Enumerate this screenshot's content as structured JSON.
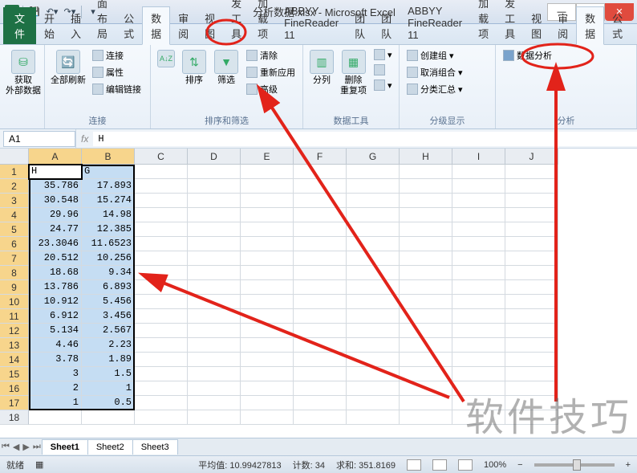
{
  "titlebar": {
    "title": "分析数据.xlsx - Microsoft Excel"
  },
  "tabs": {
    "file": "文件",
    "items": [
      "开始",
      "插入",
      "页面布局",
      "公式",
      "数据",
      "审阅",
      "视图",
      "开发工具",
      "加载项",
      "ABBYY FineReader 11",
      "团队"
    ],
    "active_index": 4
  },
  "ribbon": {
    "group_get_data": {
      "btn": "获取\n外部数据",
      "label": ""
    },
    "group_connections": {
      "refresh": "全部刷新",
      "items": [
        "连接",
        "属性",
        "编辑链接"
      ],
      "label": "连接"
    },
    "group_sort_filter": {
      "sort": "排序",
      "filter": "筛选",
      "items": [
        "清除",
        "重新应用",
        "高级"
      ],
      "label": "排序和筛选"
    },
    "group_data_tools": {
      "text_to_cols": "分列",
      "remove_dup": "删除\n重复项",
      "label": "数据工具"
    },
    "group_outline": {
      "items": [
        "创建组",
        "取消组合",
        "分类汇总"
      ],
      "label": "分级显示"
    },
    "group_analysis": {
      "btn": "数据分析",
      "label": "分析"
    }
  },
  "namebox": "A1",
  "formula": "H",
  "columns": [
    "A",
    "B",
    "C",
    "D",
    "E",
    "F",
    "G",
    "H",
    "I",
    "J"
  ],
  "headers": {
    "A": "H",
    "B": "G"
  },
  "chart_data": {
    "type": "table",
    "columns": [
      "H",
      "G"
    ],
    "rows": [
      [
        35.786,
        17.893
      ],
      [
        30.548,
        15.274
      ],
      [
        29.96,
        14.98
      ],
      [
        24.77,
        12.385
      ],
      [
        23.3046,
        11.6523
      ],
      [
        20.512,
        10.256
      ],
      [
        18.68,
        9.34
      ],
      [
        13.786,
        6.893
      ],
      [
        10.912,
        5.456
      ],
      [
        6.912,
        3.456
      ],
      [
        5.134,
        2.567
      ],
      [
        4.46,
        2.23
      ],
      [
        3.78,
        1.89
      ],
      [
        3,
        1.5
      ],
      [
        2,
        1
      ],
      [
        1,
        0.5
      ]
    ]
  },
  "sheet_tabs": [
    "Sheet1",
    "Sheet2",
    "Sheet3"
  ],
  "status": {
    "ready": "就绪",
    "avg_label": "平均值:",
    "avg": "10.99427813",
    "count_label": "计数:",
    "count": "34",
    "sum_label": "求和:",
    "sum": "351.8169",
    "zoom": "100%"
  },
  "watermark": "软件技巧"
}
